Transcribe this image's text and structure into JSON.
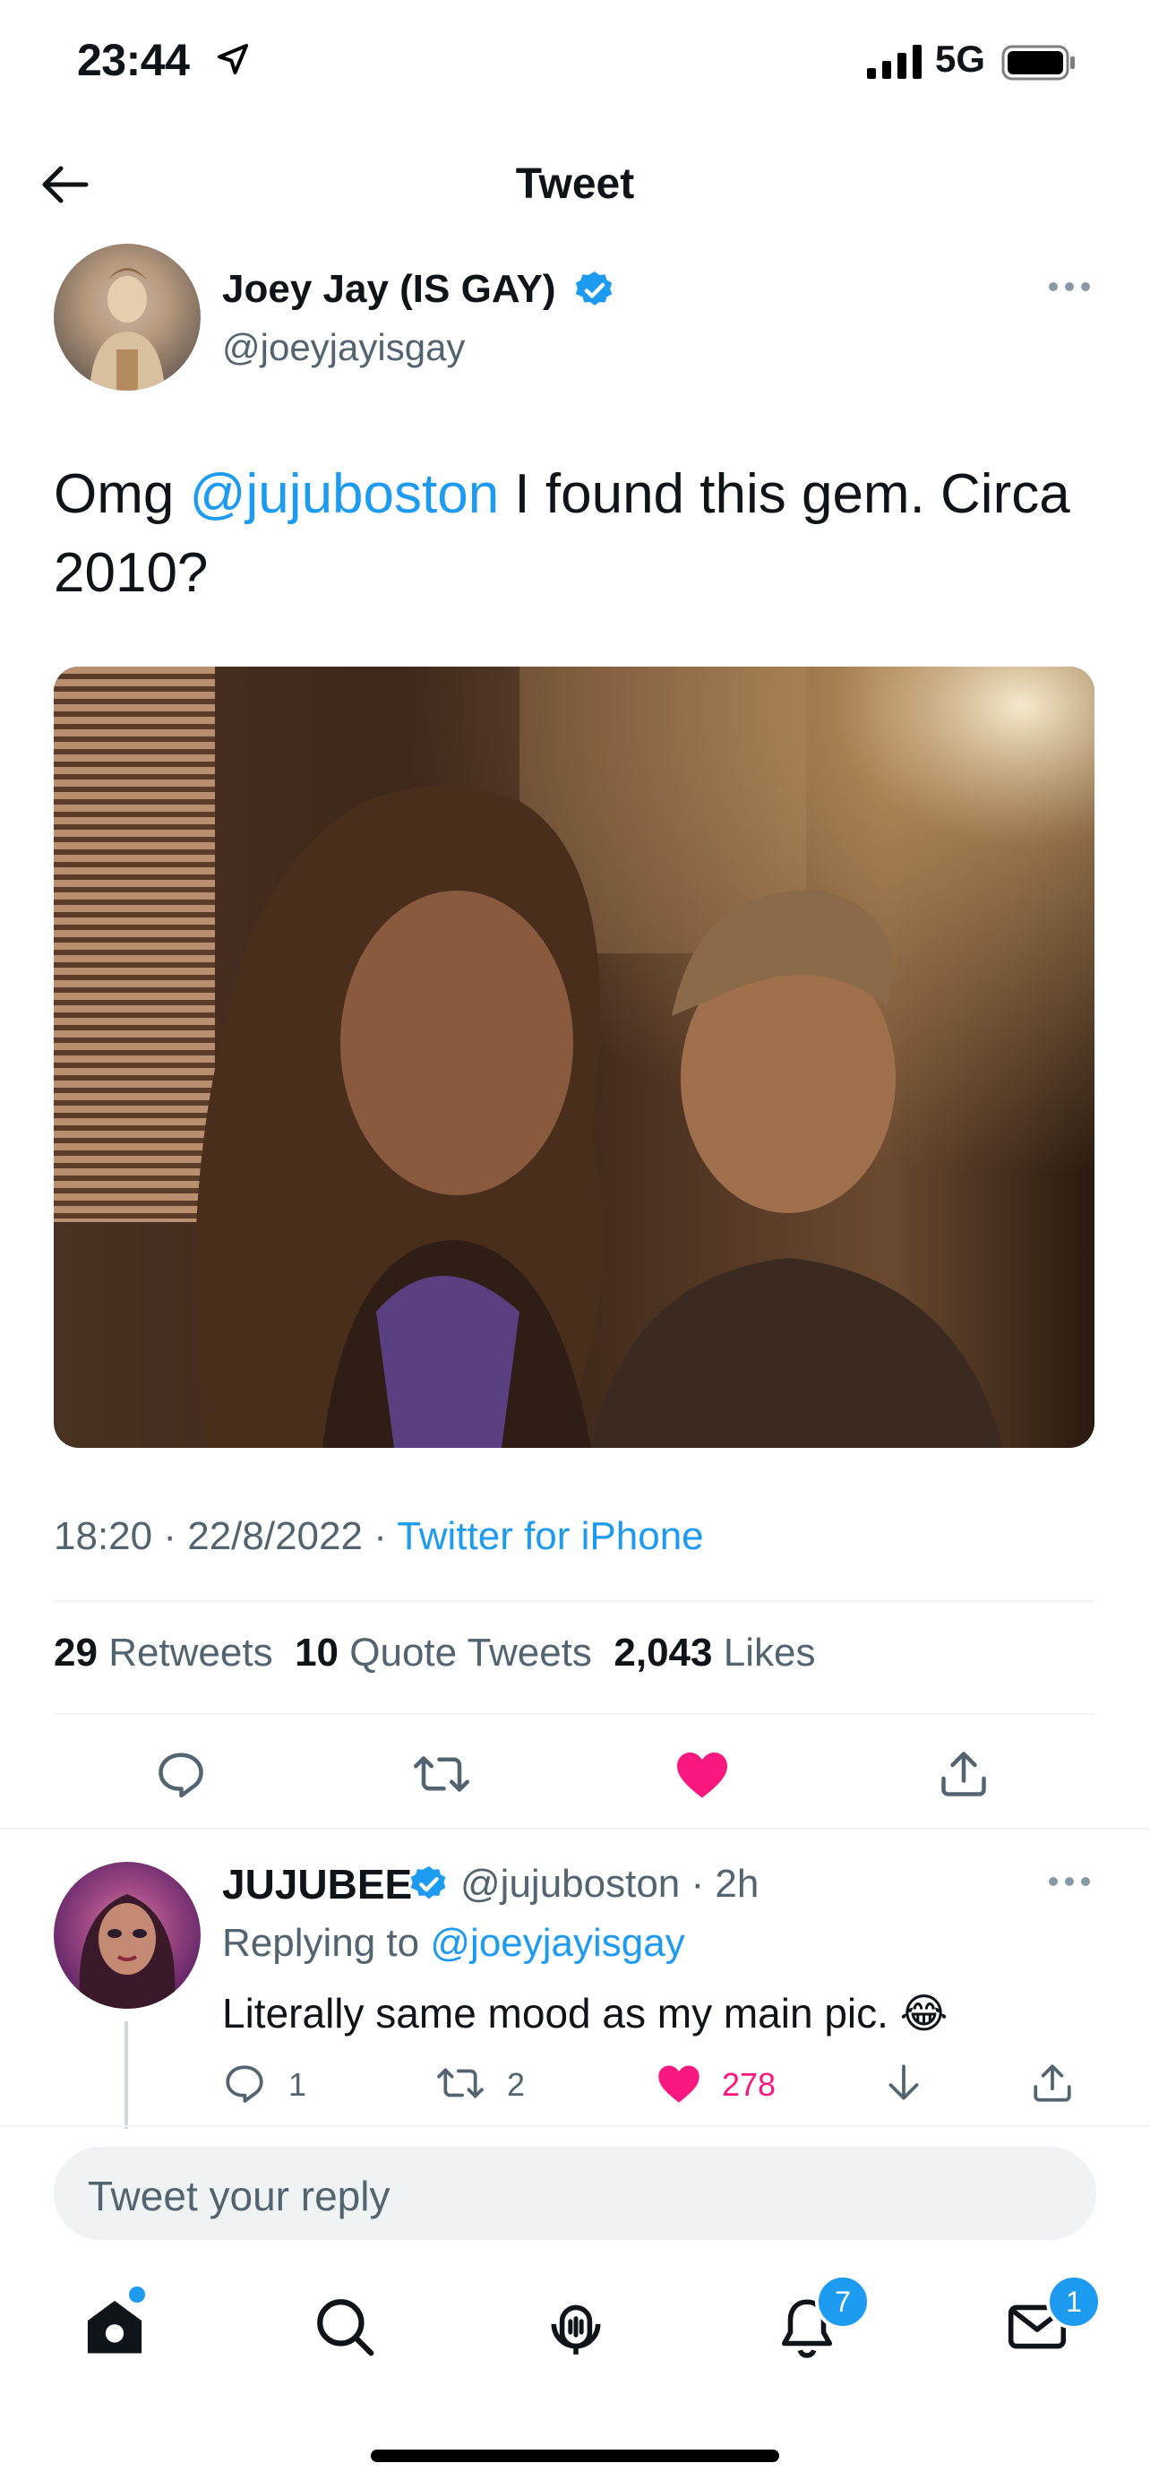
{
  "status_bar": {
    "time": "23:44",
    "network": "5G"
  },
  "header": {
    "title": "Tweet"
  },
  "tweet": {
    "author_name": "Joey Jay (IS GAY)",
    "author_handle": "@joeyjayisgay",
    "text_prefix": "Omg ",
    "mention": "@jujuboston",
    "text_suffix": " I found this gem. Circa 2010?",
    "time": "18:20",
    "date": "22/8/2022",
    "source": "Twitter for iPhone",
    "retweets_count": "29",
    "retweets_label": "Retweets",
    "quotes_count": "10",
    "quotes_label": "Quote Tweets",
    "likes_count": "2,043",
    "likes_label": "Likes"
  },
  "reply": {
    "author_name": "JUJUBEE",
    "author_handle": "@jujuboston",
    "age": "· 2h",
    "replying_to_label": "Replying to",
    "replying_to_handle": "@joeyjayisgay",
    "text": "Literally same mood as my main pic. 😂",
    "reply_count": "1",
    "retweet_count": "2",
    "like_count": "278"
  },
  "compose": {
    "placeholder": "Tweet your reply"
  },
  "tab_bar": {
    "notifications_badge": "7",
    "messages_badge": "1"
  },
  "colors": {
    "accent": "#1d9bf0",
    "like": "#f91880",
    "muted": "#536471"
  }
}
